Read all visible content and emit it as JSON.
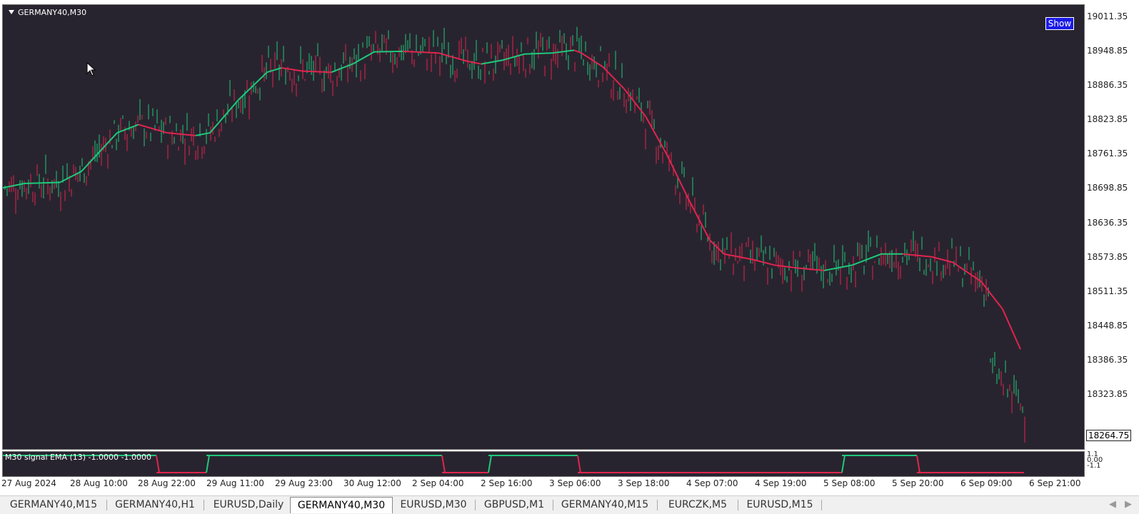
{
  "chart": {
    "title": "GERMANY40,M30",
    "show_button": "Show",
    "indicator_label": "M30 signal EMA (13) -1.0000 -1.0000",
    "current_price": "18264.75",
    "sub_axis": [
      "1.1",
      "0.00",
      "-1.1"
    ],
    "bull_color": "#1ec97a",
    "bear_color": "#e0244e",
    "background": "#28242f"
  },
  "price_axis": [
    "19011.35",
    "18948.85",
    "18886.35",
    "18823.85",
    "18761.35",
    "18698.85",
    "18636.35",
    "18573.85",
    "18511.35",
    "18448.85",
    "18386.35",
    "18323.85"
  ],
  "time_axis": [
    "27 Aug 2024",
    "28 Aug 10:00",
    "28 Aug 22:00",
    "29 Aug 11:00",
    "29 Aug 23:00",
    "30 Aug 12:00",
    "2 Sep 04:00",
    "2 Sep 16:00",
    "3 Sep 06:00",
    "3 Sep 18:00",
    "4 Sep 07:00",
    "4 Sep 19:00",
    "5 Sep 08:00",
    "5 Sep 20:00",
    "6 Sep 09:00",
    "6 Sep 21:00"
  ],
  "tabs": [
    "GERMANY40,M15",
    "GERMANY40,H1",
    "EURUSD,Daily",
    "GERMANY40,M30",
    "EURUSD,M30",
    "GBPUSD,M1",
    "GERMANY40,M15",
    "EURCZK,M5",
    "EURUSD,M15"
  ],
  "active_tab": "GERMANY40,M30",
  "chart_data": {
    "type": "candlestick",
    "symbol": "GERMANY40",
    "timeframe": "M30",
    "ylim": [
      18264.75,
      19011.35
    ],
    "ema_period": 13,
    "ema_path": [
      [
        0,
        18700
      ],
      [
        30,
        18708
      ],
      [
        80,
        18710
      ],
      [
        110,
        18730
      ],
      [
        160,
        18800
      ],
      [
        190,
        18815
      ],
      [
        230,
        18800
      ],
      [
        270,
        18795
      ],
      [
        290,
        18800
      ],
      [
        330,
        18860
      ],
      [
        370,
        18910
      ],
      [
        390,
        18918
      ],
      [
        420,
        18912
      ],
      [
        460,
        18910
      ],
      [
        490,
        18925
      ],
      [
        520,
        18947
      ],
      [
        560,
        18948
      ],
      [
        610,
        18945
      ],
      [
        650,
        18930
      ],
      [
        670,
        18925
      ],
      [
        700,
        18932
      ],
      [
        730,
        18943
      ],
      [
        770,
        18945
      ],
      [
        800,
        18950
      ],
      [
        810,
        18945
      ],
      [
        840,
        18920
      ],
      [
        870,
        18880
      ],
      [
        900,
        18830
      ],
      [
        930,
        18760
      ],
      [
        960,
        18680
      ],
      [
        990,
        18605
      ],
      [
        1010,
        18580
      ],
      [
        1050,
        18570
      ],
      [
        1080,
        18560
      ],
      [
        1110,
        18555
      ],
      [
        1150,
        18550
      ],
      [
        1190,
        18560
      ],
      [
        1230,
        18580
      ],
      [
        1260,
        18580
      ],
      [
        1300,
        18575
      ],
      [
        1330,
        18565
      ],
      [
        1370,
        18530
      ],
      [
        1400,
        18480
      ],
      [
        1425,
        18407
      ]
    ],
    "signal_segments": [
      {
        "from": 0,
        "to": 215,
        "state": "bull"
      },
      {
        "from": 215,
        "to": 285,
        "state": "bear"
      },
      {
        "from": 285,
        "to": 615,
        "state": "bull"
      },
      {
        "from": 615,
        "to": 680,
        "state": "bear"
      },
      {
        "from": 680,
        "to": 805,
        "state": "bull"
      },
      {
        "from": 805,
        "to": 1175,
        "state": "bear"
      },
      {
        "from": 1175,
        "to": 1280,
        "state": "bull"
      },
      {
        "from": 1280,
        "to": 1430,
        "state": "bear"
      }
    ]
  }
}
